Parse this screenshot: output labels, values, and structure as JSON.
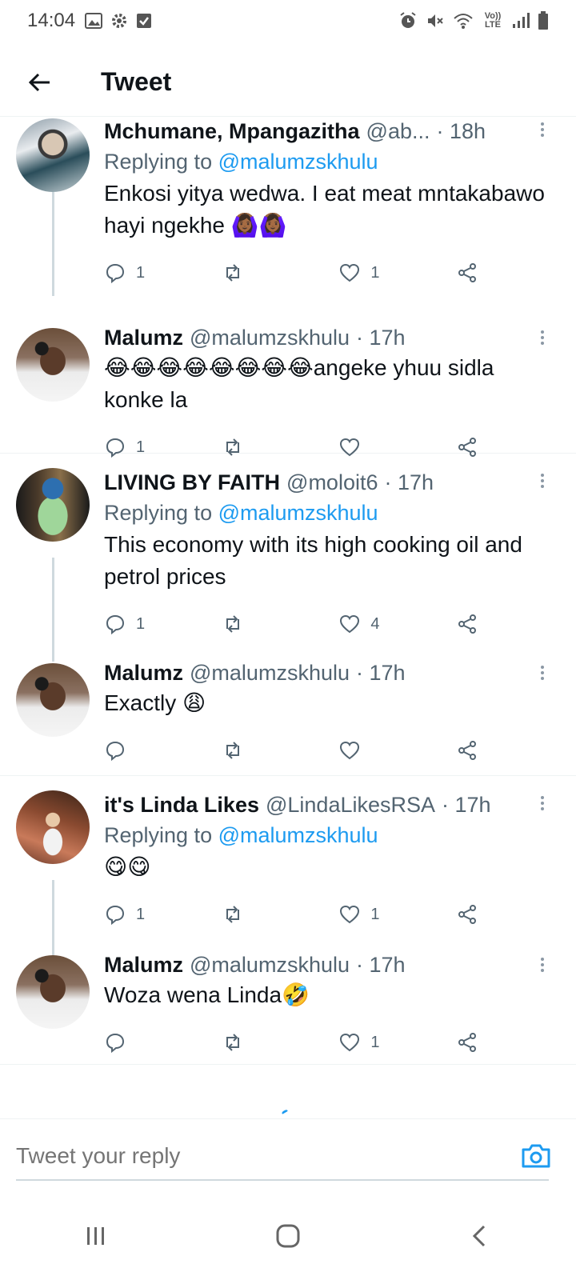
{
  "status_bar": {
    "time": "14:04",
    "network": "Vo)) LTE"
  },
  "header": {
    "title": "Tweet"
  },
  "tweets": [
    {
      "name": "Mchumane, Mpangazitha",
      "handle": "@ab...",
      "time": "· 18h",
      "replying_prefix": "Replying to ",
      "replying_to": "@malumzskhulu",
      "text": "Enkosi yitya wedwa. I eat meat mntakabawo hayi ngekhe 🙆🏾‍♀️🙆🏾‍♀️",
      "replies": "1",
      "retweets": "",
      "likes": "1"
    },
    {
      "name": "Malumz",
      "handle": "@malumzskhulu",
      "time": "· 17h",
      "replying_prefix": "",
      "replying_to": "",
      "text": "😂😂😂😂😂😂😂😂angeke yhuu sidla konke la",
      "replies": "1",
      "retweets": "",
      "likes": ""
    },
    {
      "name": "LIVING BY FAITH",
      "handle": "@moloit6",
      "time": "· 17h",
      "replying_prefix": "Replying to ",
      "replying_to": "@malumzskhulu",
      "text": "This economy with its high cooking oil and petrol prices",
      "replies": "1",
      "retweets": "",
      "likes": "4"
    },
    {
      "name": "Malumz",
      "handle": "@malumzskhulu",
      "time": "· 17h",
      "replying_prefix": "",
      "replying_to": "",
      "text": "Exactly 😩",
      "replies": "",
      "retweets": "",
      "likes": ""
    },
    {
      "name": "it's Linda Likes",
      "handle": "@LindaLikesRSA",
      "time": "· 17h",
      "replying_prefix": "Replying to ",
      "replying_to": "@malumzskhulu",
      "text": "😋😋",
      "replies": "1",
      "retweets": "",
      "likes": "1"
    },
    {
      "name": "Malumz",
      "handle": "@malumzskhulu",
      "time": "· 17h",
      "replying_prefix": "",
      "replying_to": "",
      "text": "Woza wena Linda🤣",
      "replies": "",
      "retweets": "",
      "likes": "1"
    }
  ],
  "reply_bar": {
    "placeholder": "Tweet your reply"
  },
  "colors": {
    "accent": "#1d9bf0",
    "text": "#0f1419",
    "secondary": "#536471",
    "border": "#eff3f4"
  }
}
